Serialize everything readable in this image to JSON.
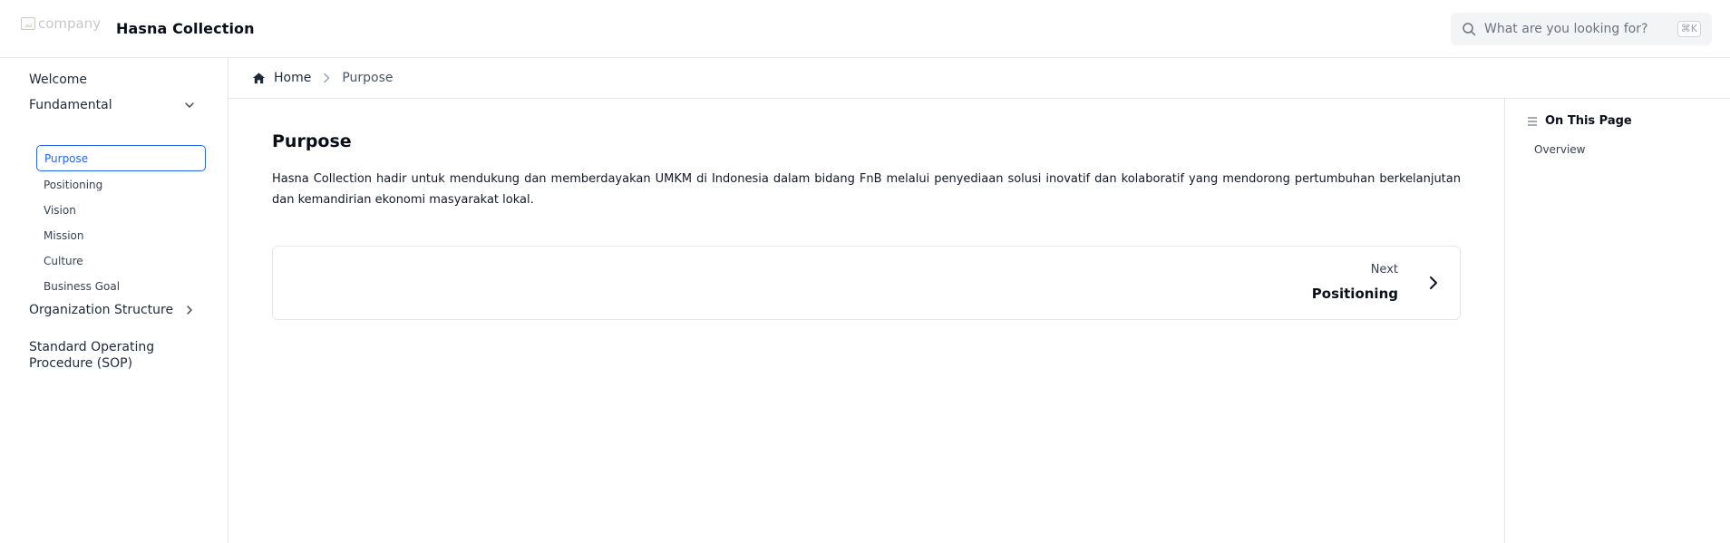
{
  "header": {
    "logo_alt": "company",
    "brand": "Hasna Collection",
    "search_placeholder": "What are you looking for?",
    "shortcut": "⌘K"
  },
  "sidebar": {
    "welcome": "Welcome",
    "fundamental": {
      "label": "Fundamental",
      "expanded": true,
      "items": [
        "Purpose",
        "Positioning",
        "Vision",
        "Mission",
        "Culture",
        "Business Goal"
      ],
      "active": "Purpose"
    },
    "org_structure": {
      "label": "Organization Structure",
      "expanded": false
    },
    "sop": "Standard Operating Procedure (SOP)"
  },
  "breadcrumb": {
    "home": "Home",
    "current": "Purpose"
  },
  "main": {
    "title": "Purpose",
    "paragraph": "Hasna Collection hadir untuk mendukung dan memberdayakan UMKM di Indonesia dalam bidang FnB melalui penyediaan solusi inovatif dan kolaboratif yang mendorong pertumbuhan berkelanjutan dan kemandirian ekonomi masyarakat lokal.",
    "next": {
      "label": "Next",
      "title": "Positioning"
    }
  },
  "on_this_page": {
    "heading": "On This Page",
    "items": [
      "Overview"
    ]
  },
  "colors": {
    "accent": "#2563eb",
    "border": "#e5e7eb",
    "search_bg": "#f3f4f6"
  }
}
